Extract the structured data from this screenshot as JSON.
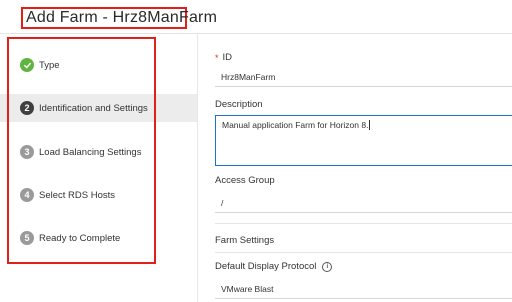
{
  "header": {
    "title": "Add Farm - Hrz8ManFarm"
  },
  "steps": [
    {
      "label": "Type",
      "status": "done",
      "number": ""
    },
    {
      "label": "Identification and Settings",
      "status": "current",
      "number": "2"
    },
    {
      "label": "Load Balancing Settings",
      "status": "todo",
      "number": "3"
    },
    {
      "label": "Select RDS Hosts",
      "status": "todo",
      "number": "4"
    },
    {
      "label": "Ready to Complete",
      "status": "todo",
      "number": "5"
    }
  ],
  "form": {
    "id_required_mark": "*",
    "id_label": "ID",
    "id_value": "Hrz8ManFarm",
    "description_label": "Description",
    "description_value": "Manual application Farm for Horizon 8.",
    "access_group_label": "Access Group",
    "access_group_value": "/",
    "farm_settings_label": "Farm Settings",
    "display_protocol_label": "Default Display Protocol",
    "display_protocol_value": "VMware Blast"
  },
  "colors": {
    "highlight_border": "#e0201b",
    "step_done": "#5fb53f",
    "step_current": "#404040",
    "step_todo": "#9a9a9a",
    "focus_border": "#1a74c9"
  }
}
